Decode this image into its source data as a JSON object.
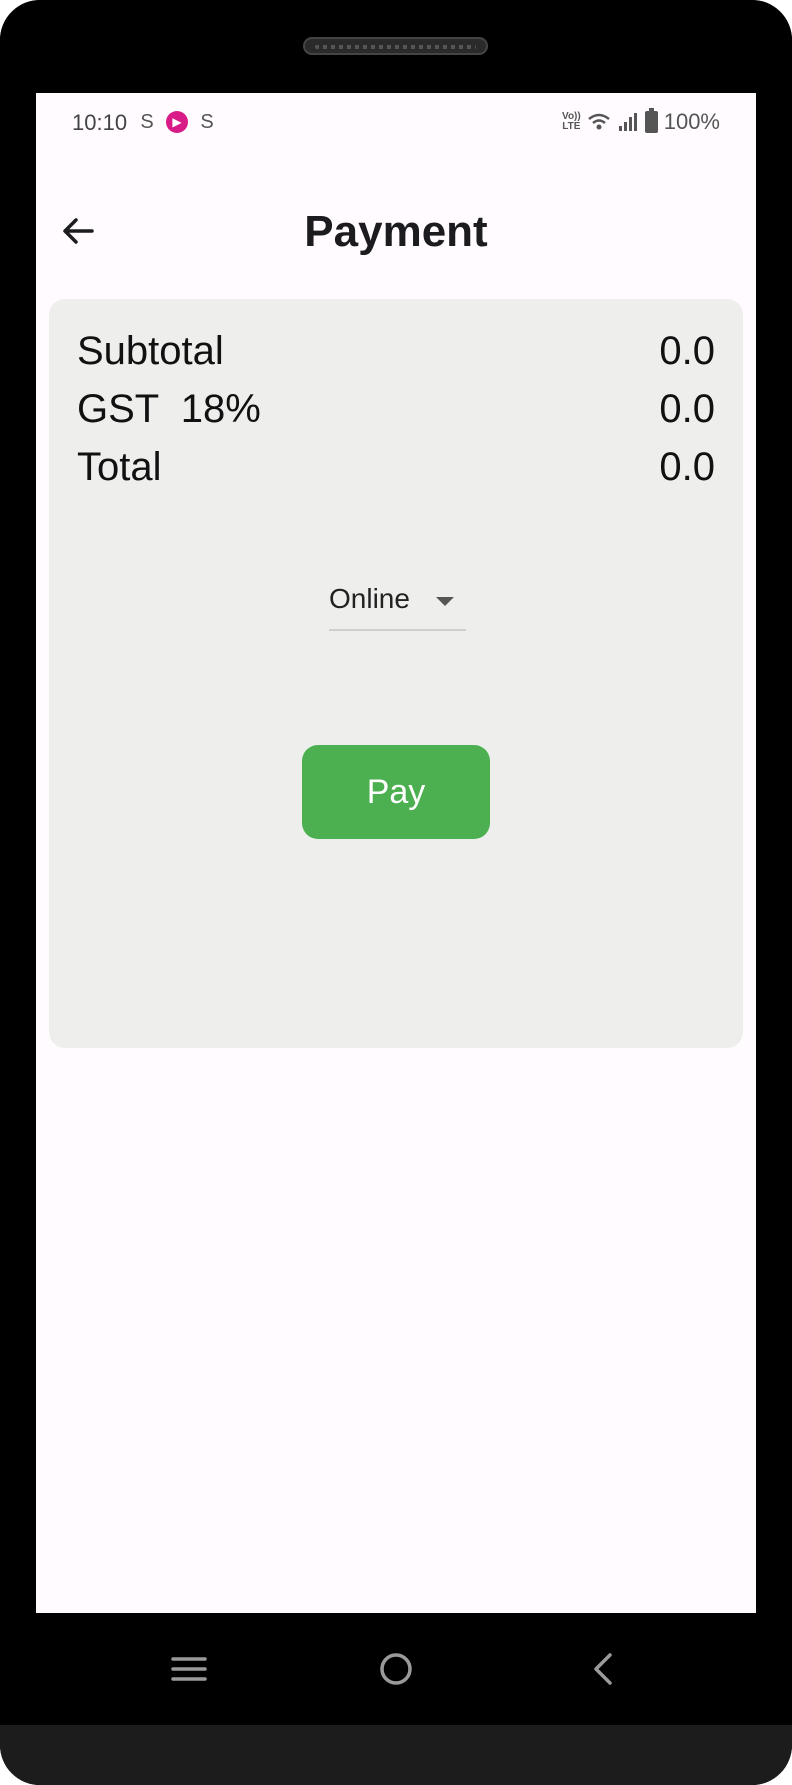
{
  "status_bar": {
    "time": "10:10",
    "notification_icons": [
      "s-icon",
      "video-app-icon",
      "s-icon"
    ],
    "volte_line1": "Vo))",
    "volte_line2": "LTE",
    "battery": "100%"
  },
  "app_bar": {
    "title": "Payment",
    "back_icon": "arrow-back-icon"
  },
  "summary": {
    "rows": [
      {
        "label": "Subtotal",
        "value": "0.0"
      },
      {
        "label": "GST  18%",
        "value": "0.0"
      },
      {
        "label": "Total",
        "value": "0.0"
      }
    ]
  },
  "payment_method": {
    "selected": "Online"
  },
  "pay_button": {
    "label": "Pay"
  },
  "colors": {
    "accent": "#4caf50",
    "card": "#eeefed",
    "background": "#fffbfe"
  },
  "nav_bar": {
    "icons": [
      "menu-icon",
      "home-icon",
      "back-icon"
    ]
  }
}
